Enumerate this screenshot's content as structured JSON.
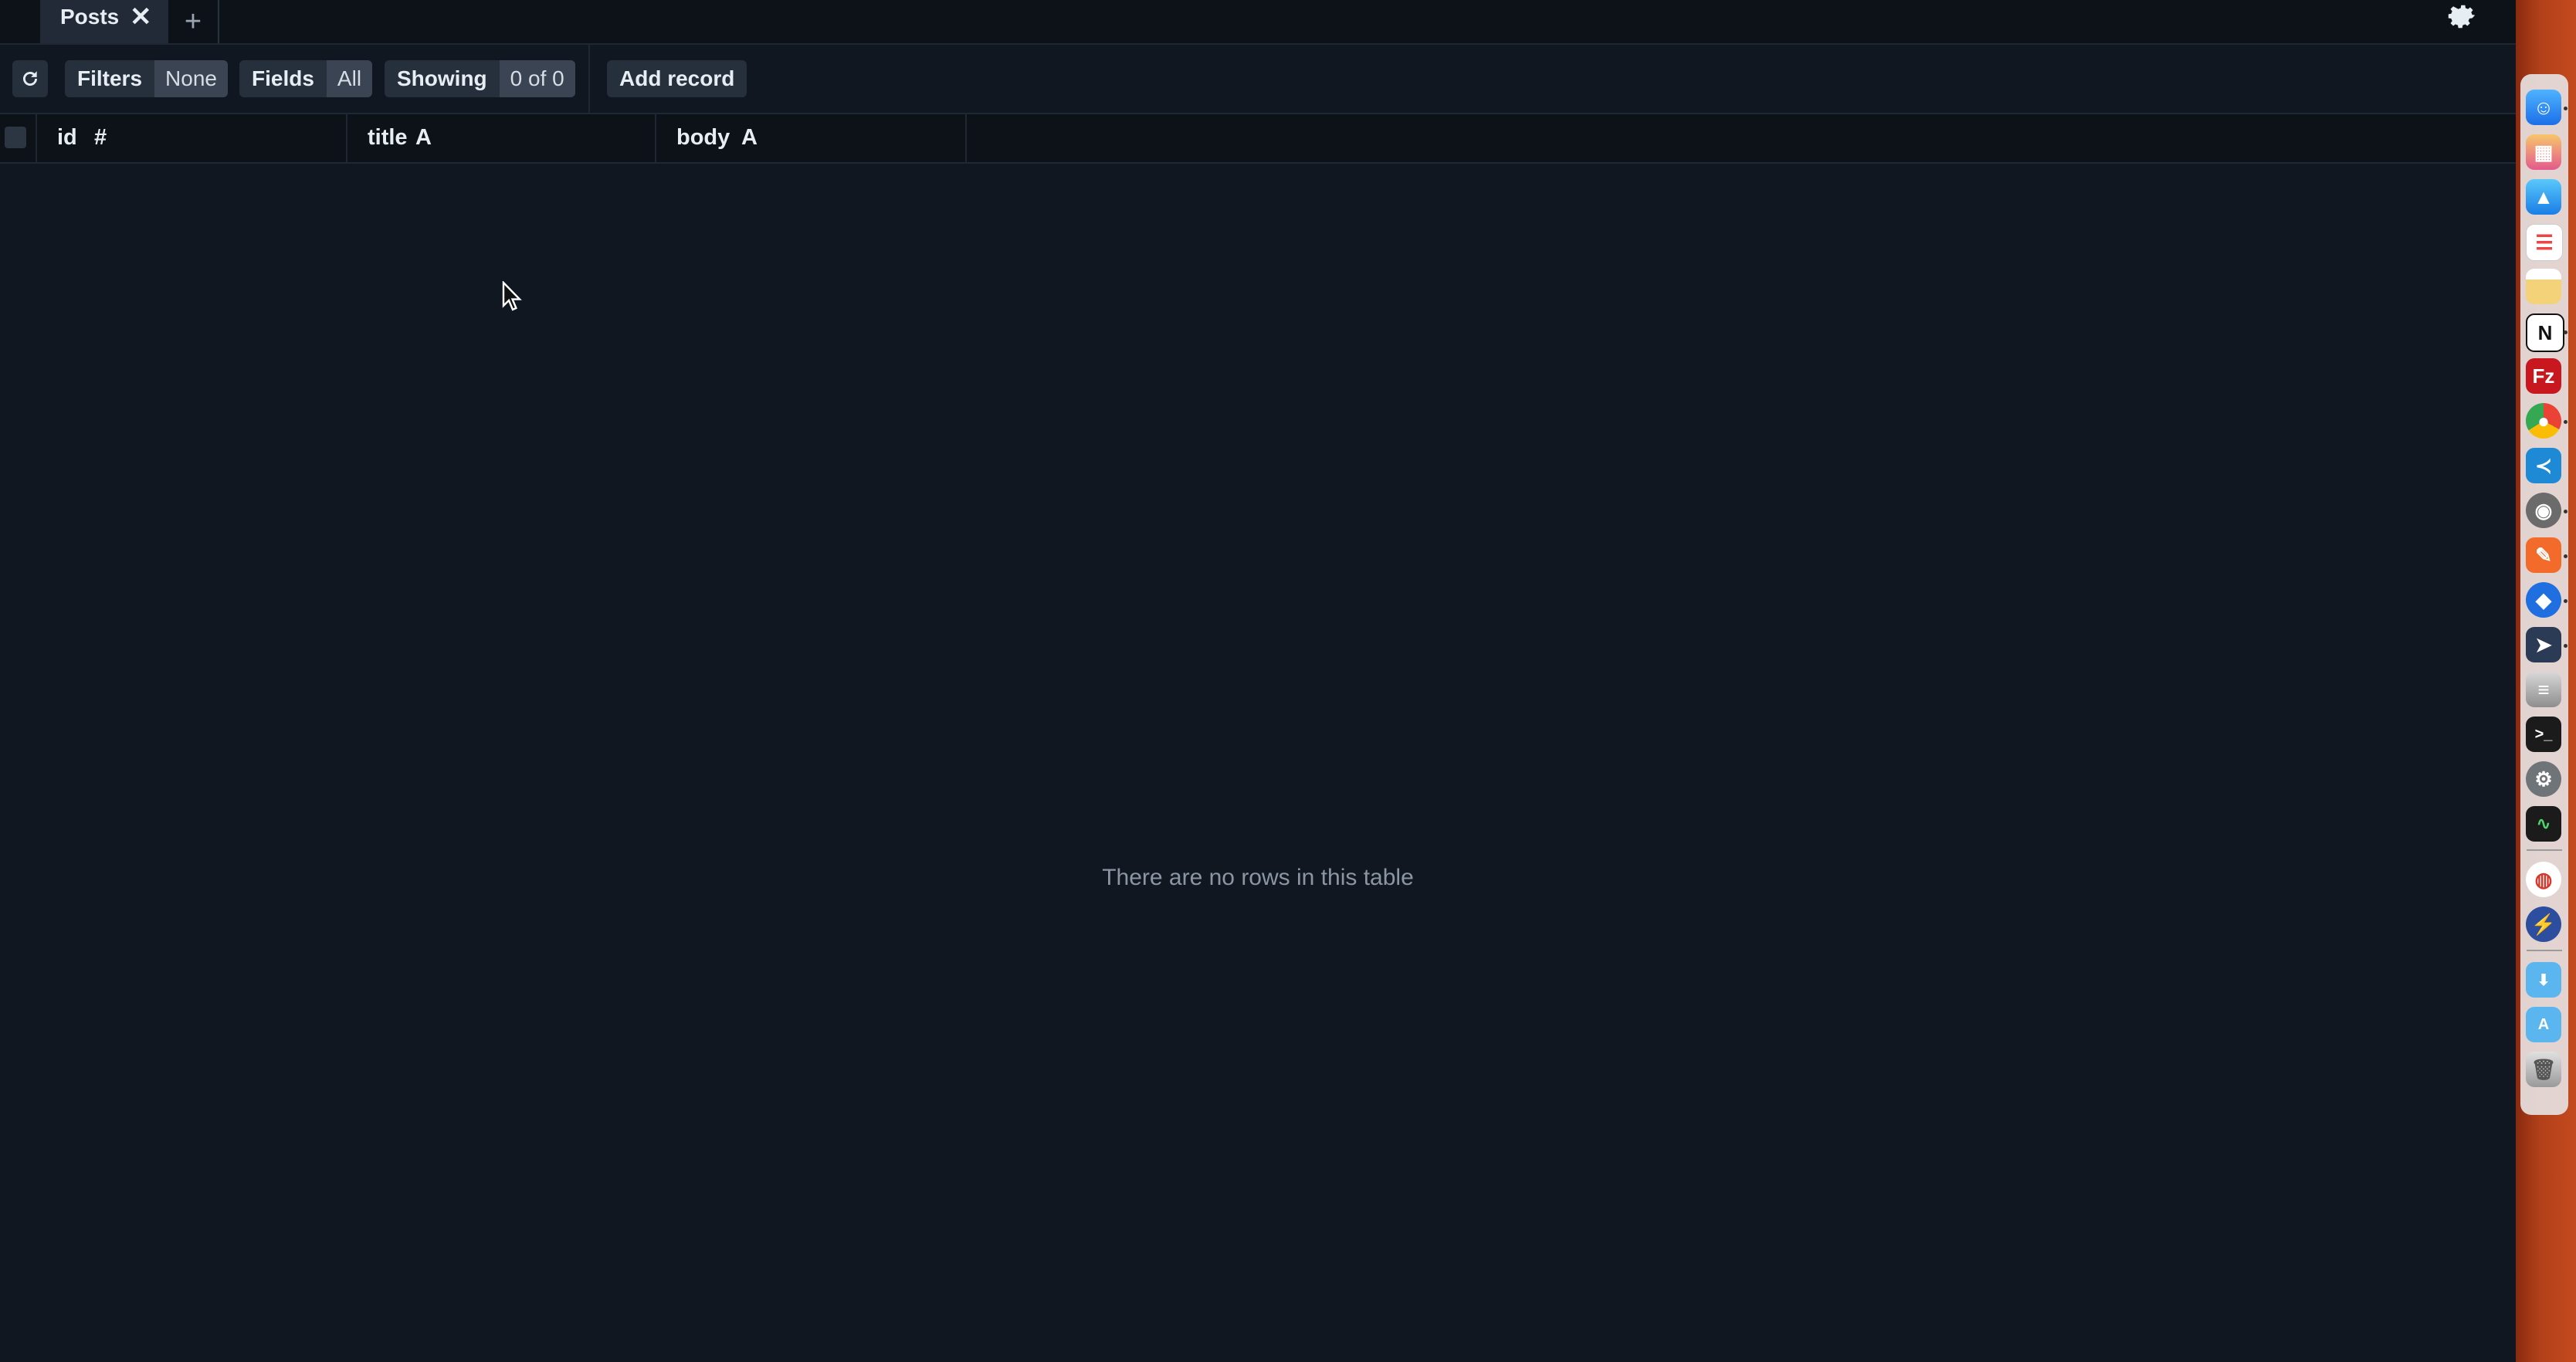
{
  "tabs": [
    {
      "label": "Posts",
      "close": "✕"
    }
  ],
  "tab_add": "+",
  "toolbar": {
    "refresh_icon": "refresh-icon",
    "filters_label": "Filters",
    "filters_value": "None",
    "fields_label": "Fields",
    "fields_value": "All",
    "showing_label": "Showing",
    "showing_value": "0 of 0",
    "add_record_label": "Add record"
  },
  "columns": [
    {
      "name": "id",
      "type": "#"
    },
    {
      "name": "title",
      "type": "A"
    },
    {
      "name": "body",
      "type": "A"
    }
  ],
  "empty_message": "There are no rows in this table",
  "colors": {
    "background": "#111721",
    "header_bg": "#0d1219",
    "button_bg": "#262f3c",
    "accent_dock": "#c44a1e"
  },
  "dock_apps": [
    "finder-icon",
    "launchpad-icon",
    "testflight-icon",
    "reminders-icon",
    "notes-icon",
    "notion-icon",
    "filezilla-icon",
    "chrome-icon",
    "vscode-icon",
    "tableplus-icon",
    "sketch-icon",
    "maps-icon",
    "telegram-icon",
    "sequel-icon",
    "terminal-icon",
    "system-preferences-icon",
    "activity-monitor-icon",
    "scrobbles-icon",
    "reeder-icon",
    "downloads-folder-icon",
    "applications-folder-icon",
    "trash-icon"
  ]
}
